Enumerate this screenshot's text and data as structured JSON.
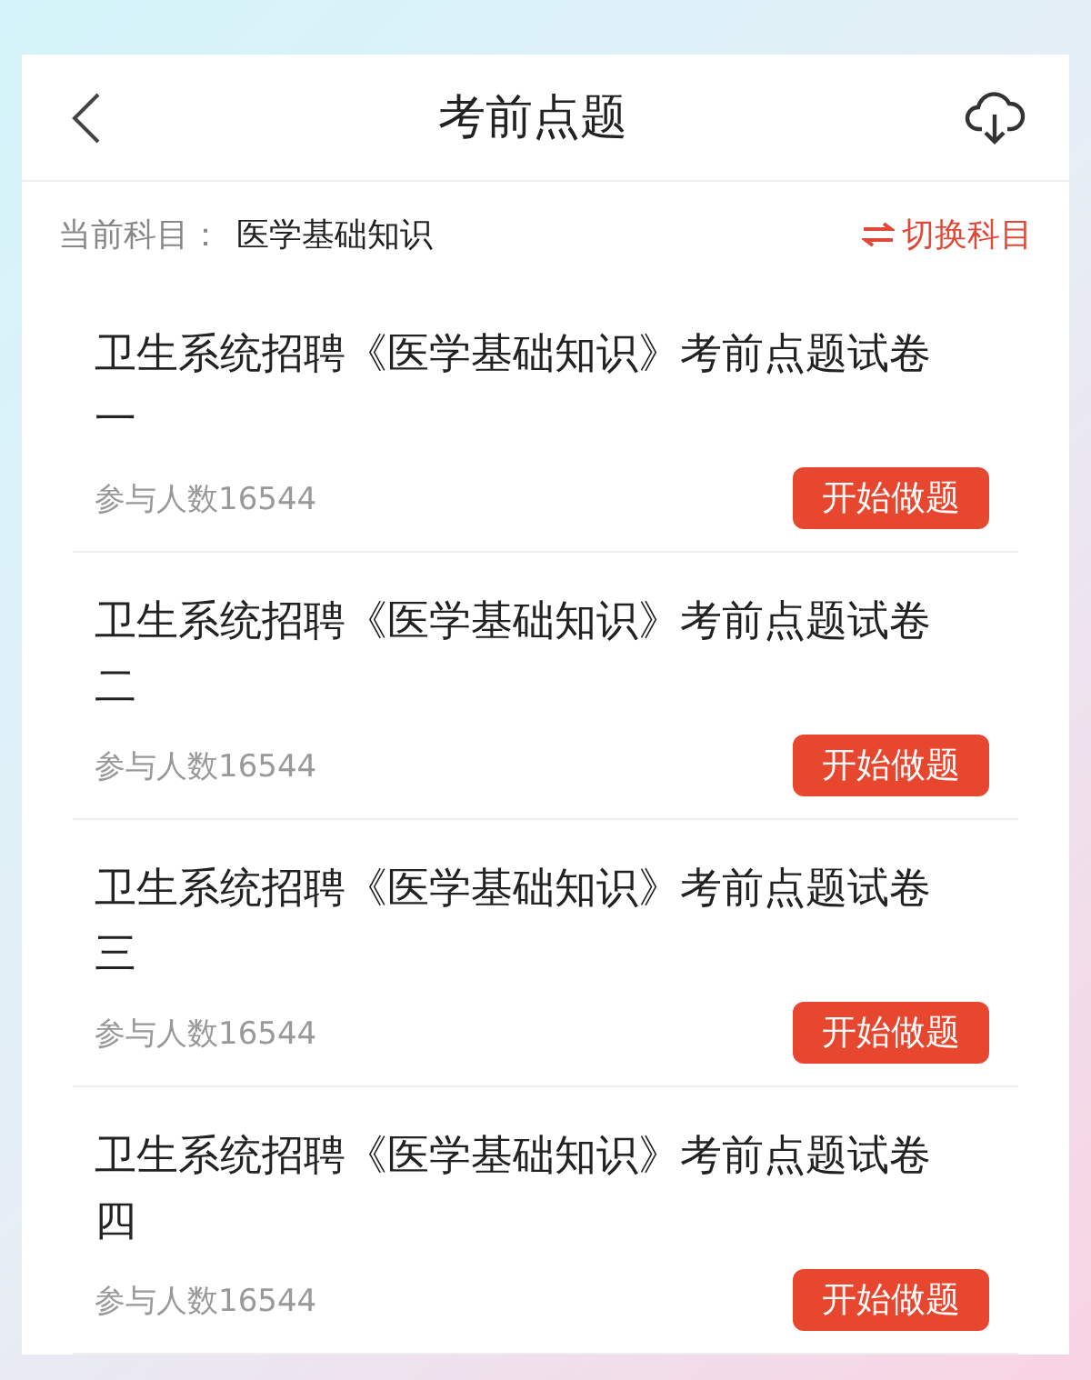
{
  "header": {
    "title": "考前点题"
  },
  "subject": {
    "label": "当前科目：",
    "value": "医学基础知识",
    "switch": "切换科目"
  },
  "papers": [
    {
      "title": "卫生系统招聘《医学基础知识》考前点题试卷一",
      "participants": "参与人数16544",
      "action": "开始做题"
    },
    {
      "title": "卫生系统招聘《医学基础知识》考前点题试卷二",
      "participants": "参与人数16544",
      "action": "开始做题"
    },
    {
      "title": "卫生系统招聘《医学基础知识》考前点题试卷三",
      "participants": "参与人数16544",
      "action": "开始做题"
    },
    {
      "title": "卫生系统招聘《医学基础知识》考前点题试卷四",
      "participants": "参与人数16544",
      "action": "开始做题"
    }
  ]
}
